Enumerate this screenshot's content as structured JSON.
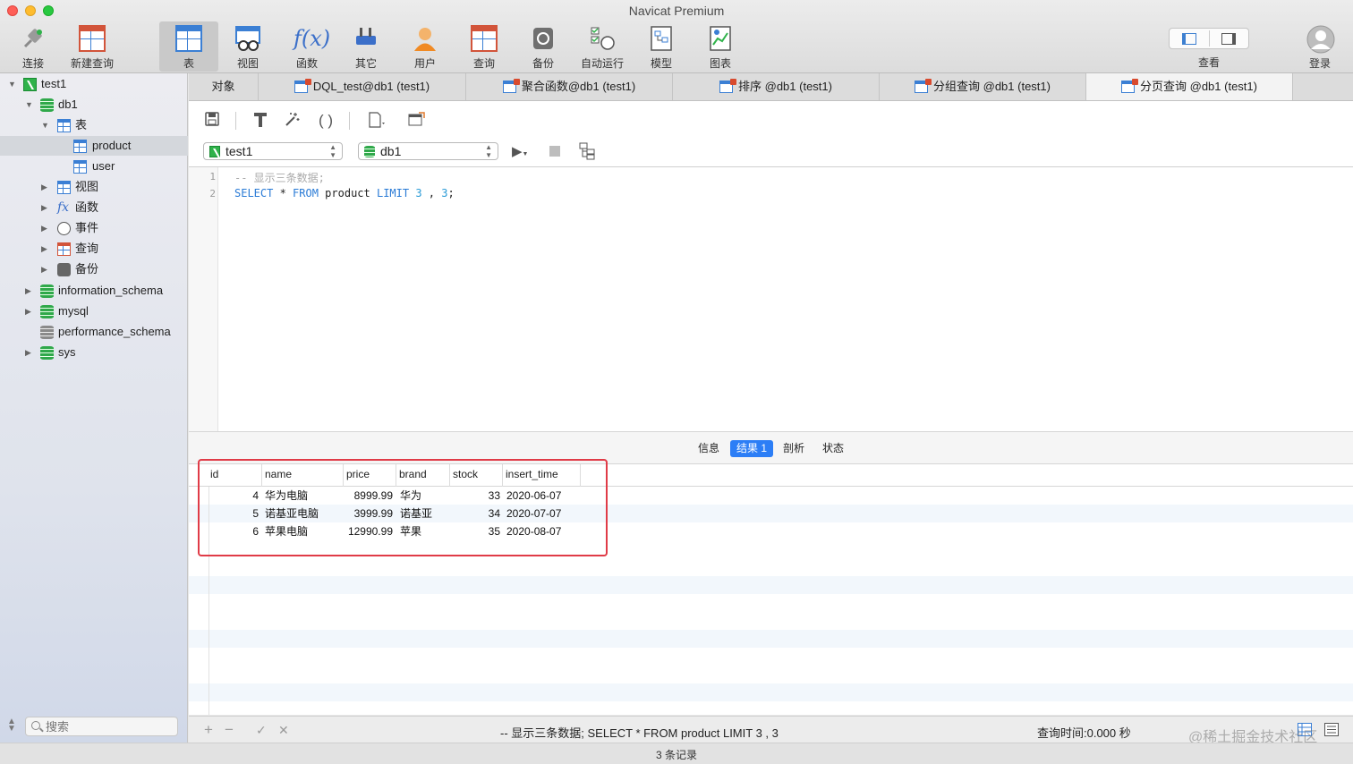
{
  "window": {
    "title": "Navicat Premium"
  },
  "toolbar": {
    "items": [
      {
        "label": "连接",
        "icon": "plug-icon"
      },
      {
        "label": "新建查询",
        "icon": "new-query-icon"
      },
      {
        "label": "表",
        "icon": "table-icon"
      },
      {
        "label": "视图",
        "icon": "view-icon"
      },
      {
        "label": "函数",
        "icon": "function-icon"
      },
      {
        "label": "其它",
        "icon": "tools-icon"
      },
      {
        "label": "用户",
        "icon": "user-icon"
      },
      {
        "label": "查询",
        "icon": "query-icon"
      },
      {
        "label": "备份",
        "icon": "backup-icon"
      },
      {
        "label": "自动运行",
        "icon": "schedule-icon"
      },
      {
        "label": "模型",
        "icon": "model-icon"
      },
      {
        "label": "图表",
        "icon": "chart-icon"
      }
    ],
    "view_label": "查看",
    "login_label": "登录"
  },
  "sidebar": {
    "tree": [
      {
        "label": "test1"
      },
      {
        "label": "db1"
      },
      {
        "label": "表"
      },
      {
        "label": "product"
      },
      {
        "label": "user"
      },
      {
        "label": "视图"
      },
      {
        "label": "函数"
      },
      {
        "label": "事件"
      },
      {
        "label": "查询"
      },
      {
        "label": "备份"
      },
      {
        "label": "information_schema"
      },
      {
        "label": "mysql"
      },
      {
        "label": "performance_schema"
      },
      {
        "label": "sys"
      }
    ],
    "search_placeholder": "搜索"
  },
  "tabs": [
    {
      "label": "对象"
    },
    {
      "label": "DQL_test@db1 (test1)"
    },
    {
      "label": "聚合函数@db1 (test1)"
    },
    {
      "label": "排序 @db1 (test1)"
    },
    {
      "label": "分组查询 @db1 (test1)"
    },
    {
      "label": "分页查询 @db1 (test1)"
    }
  ],
  "editor": {
    "connection": "test1",
    "database": "db1",
    "lines": [
      "1",
      "2"
    ],
    "comment": "-- 显示三条数据;",
    "sql_select": "SELECT",
    "sql_star": " * ",
    "sql_from": "FROM",
    "sql_table": " product ",
    "sql_limit": "LIMIT",
    "sql_n1": "3",
    "sql_comma": " , ",
    "sql_n2": "3",
    "sql_end": ";"
  },
  "result_tabs": [
    "信息",
    "结果 1",
    "剖析",
    "状态"
  ],
  "result": {
    "columns": [
      "id",
      "name",
      "price",
      "brand",
      "stock",
      "insert_time"
    ],
    "rows": [
      [
        "4",
        "华为电脑",
        "8999.99",
        "华为",
        "33",
        "2020-06-07"
      ],
      [
        "5",
        "诺基亚电脑",
        "3999.99",
        "诺基亚",
        "34",
        "2020-07-07"
      ],
      [
        "6",
        "苹果电脑",
        "12990.99",
        "苹果",
        "35",
        "2020-08-07"
      ]
    ]
  },
  "status": {
    "add": "+",
    "remove": "−",
    "apply": "✓",
    "cancel": "✕",
    "sql": "-- 显示三条数据; SELECT * FROM product LIMIT 3 , 3",
    "query_time": "查询时间:0.000 秒",
    "watermark": "@稀土掘金技术社区",
    "records": "3 条记录"
  },
  "colors": {
    "accent": "#2c7ef6",
    "highlight": "#e03b47",
    "keyword": "#2a7bd6"
  }
}
